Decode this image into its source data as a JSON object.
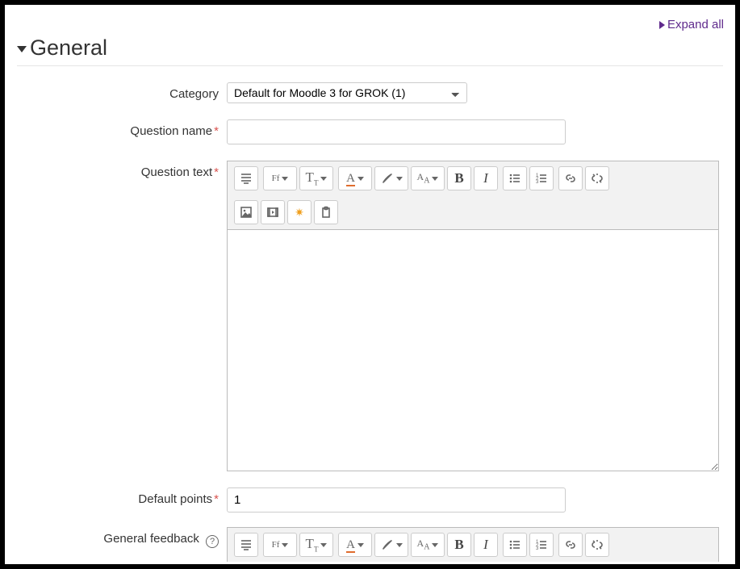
{
  "expand_all": "Expand all",
  "section_title": "General",
  "labels": {
    "category": "Category",
    "question_name": "Question name",
    "question_text": "Question text",
    "default_points": "Default points",
    "general_feedback": "General feedback"
  },
  "category_value": "Default for Moodle 3 for GROK (1)",
  "question_name_value": "",
  "question_text_value": "",
  "default_points_value": "1",
  "general_feedback_value": ""
}
